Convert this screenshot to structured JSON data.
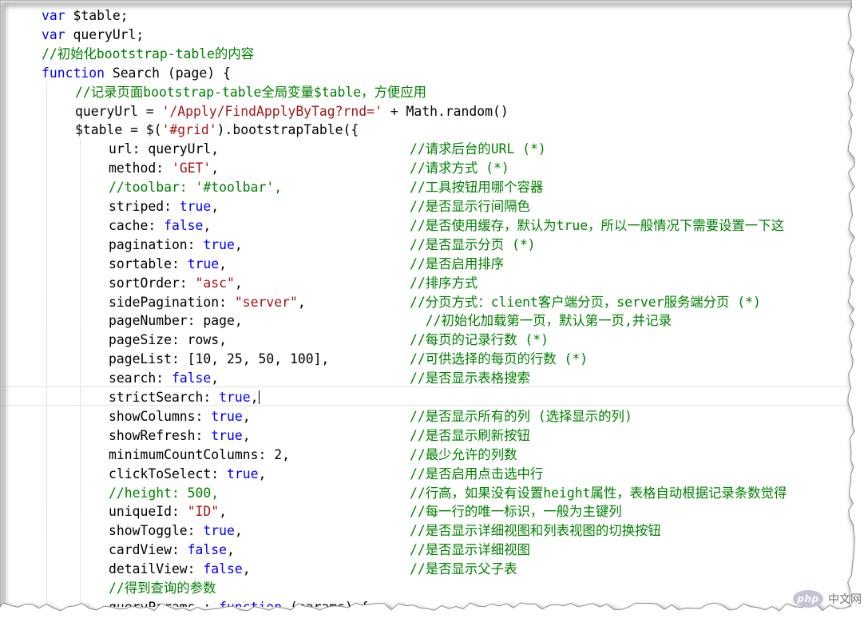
{
  "theme": {
    "keyword": "#0000ff",
    "string": "#a31515",
    "comment": "#008000",
    "plain": "#000000"
  },
  "editor": {
    "lines": [
      [
        {
          "t": "var",
          "c": "keyword"
        },
        {
          "t": " $table;",
          "c": "plain"
        }
      ],
      [
        {
          "t": "var",
          "c": "keyword"
        },
        {
          "t": " queryUrl;",
          "c": "plain"
        }
      ],
      [
        {
          "t": "//初始化bootstrap-table的内容",
          "c": "comment"
        }
      ],
      [
        {
          "t": "function",
          "c": "keyword"
        },
        {
          "t": " Search (page) {",
          "c": "plain"
        }
      ],
      [
        {
          "t": "//记录页面bootstrap-table全局变量$table，方便应用",
          "c": "comment"
        }
      ],
      [
        {
          "t": "queryUrl = ",
          "c": "plain"
        },
        {
          "t": "'/Apply/FindApplyByTag?rnd='",
          "c": "string"
        },
        {
          "t": " + Math.random()",
          "c": "plain"
        }
      ],
      [
        {
          "t": "$table = $(",
          "c": "plain"
        },
        {
          "t": "'#grid'",
          "c": "string"
        },
        {
          "t": ").bootstrapTable({",
          "c": "plain"
        }
      ],
      [
        {
          "t": "url: queryUrl,",
          "c": "plain"
        },
        {
          "t": "//请求后台的URL (*)",
          "c": "comment",
          "pad": true
        }
      ],
      [
        {
          "t": "method: ",
          "c": "plain"
        },
        {
          "t": "'GET'",
          "c": "string"
        },
        {
          "t": ",",
          "c": "plain"
        },
        {
          "t": "//请求方式 (*)",
          "c": "comment",
          "pad": true
        }
      ],
      [
        {
          "t": "//toolbar: '#toolbar',",
          "c": "comment"
        },
        {
          "t": "//工具按钮用哪个容器",
          "c": "comment",
          "pad": true
        }
      ],
      [
        {
          "t": "striped: ",
          "c": "plain"
        },
        {
          "t": "true",
          "c": "keyword"
        },
        {
          "t": ",",
          "c": "plain"
        },
        {
          "t": "//是否显示行间隔色",
          "c": "comment",
          "pad": true
        }
      ],
      [
        {
          "t": "cache: ",
          "c": "plain"
        },
        {
          "t": "false",
          "c": "keyword"
        },
        {
          "t": ",",
          "c": "plain"
        },
        {
          "t": "//是否使用缓存，默认为true，所以一般情况下需要设置一下这",
          "c": "comment",
          "pad": true
        }
      ],
      [
        {
          "t": "pagination: ",
          "c": "plain"
        },
        {
          "t": "true",
          "c": "keyword"
        },
        {
          "t": ",",
          "c": "plain"
        },
        {
          "t": "//是否显示分页 (*)",
          "c": "comment",
          "pad": true
        }
      ],
      [
        {
          "t": "sortable: ",
          "c": "plain"
        },
        {
          "t": "true",
          "c": "keyword"
        },
        {
          "t": ",",
          "c": "plain"
        },
        {
          "t": "//是否启用排序",
          "c": "comment",
          "pad": true
        }
      ],
      [
        {
          "t": "sortOrder: ",
          "c": "plain"
        },
        {
          "t": "\"asc\"",
          "c": "string"
        },
        {
          "t": ",",
          "c": "plain"
        },
        {
          "t": "//排序方式",
          "c": "comment",
          "pad": true
        }
      ],
      [
        {
          "t": "sidePagination: ",
          "c": "plain"
        },
        {
          "t": "\"server\"",
          "c": "string"
        },
        {
          "t": ",",
          "c": "plain"
        },
        {
          "t": "//分页方式：client客户端分页，server服务端分页 (*)",
          "c": "comment",
          "pad": true
        }
      ],
      [
        {
          "t": "pageNumber: page,",
          "c": "plain"
        },
        {
          "t": "  //初始化加载第一页，默认第一页,并记录",
          "c": "comment",
          "pad": true
        }
      ],
      [
        {
          "t": "pageSize: rows,",
          "c": "plain"
        },
        {
          "t": "//每页的记录行数 (*)",
          "c": "comment",
          "pad": true
        }
      ],
      [
        {
          "t": "pageList: [10, 25, 50, 100],",
          "c": "plain"
        },
        {
          "t": "//可供选择的每页的行数 (*)",
          "c": "comment",
          "pad": true
        }
      ],
      [
        {
          "t": "search: ",
          "c": "plain"
        },
        {
          "t": "false",
          "c": "keyword"
        },
        {
          "t": ",",
          "c": "plain"
        },
        {
          "t": "//是否显示表格搜索",
          "c": "comment",
          "pad": true
        }
      ],
      [
        {
          "t": "strictSearch: ",
          "c": "plain"
        },
        {
          "t": "true",
          "c": "keyword"
        },
        {
          "t": ",",
          "c": "plain"
        }
      ],
      [
        {
          "t": "showColumns: ",
          "c": "plain"
        },
        {
          "t": "true",
          "c": "keyword"
        },
        {
          "t": ",",
          "c": "plain"
        },
        {
          "t": "//是否显示所有的列 (选择显示的列)",
          "c": "comment",
          "pad": true
        }
      ],
      [
        {
          "t": "showRefresh: ",
          "c": "plain"
        },
        {
          "t": "true",
          "c": "keyword"
        },
        {
          "t": ",",
          "c": "plain"
        },
        {
          "t": "//是否显示刷新按钮",
          "c": "comment",
          "pad": true
        }
      ],
      [
        {
          "t": "minimumCountColumns: 2,",
          "c": "plain"
        },
        {
          "t": "//最少允许的列数",
          "c": "comment",
          "pad": true
        }
      ],
      [
        {
          "t": "clickToSelect: ",
          "c": "plain"
        },
        {
          "t": "true",
          "c": "keyword"
        },
        {
          "t": ",",
          "c": "plain"
        },
        {
          "t": "//是否启用点击选中行",
          "c": "comment",
          "pad": true
        }
      ],
      [
        {
          "t": "//height: 500,",
          "c": "comment"
        },
        {
          "t": "//行高，如果没有设置height属性，表格自动根据记录条数觉得",
          "c": "comment",
          "pad": true
        }
      ],
      [
        {
          "t": "uniqueId: ",
          "c": "plain"
        },
        {
          "t": "\"ID\"",
          "c": "string"
        },
        {
          "t": ",",
          "c": "plain"
        },
        {
          "t": "//每一行的唯一标识，一般为主键列",
          "c": "comment",
          "pad": true
        }
      ],
      [
        {
          "t": "showToggle: ",
          "c": "plain"
        },
        {
          "t": "true",
          "c": "keyword"
        },
        {
          "t": ",",
          "c": "plain"
        },
        {
          "t": "//是否显示详细视图和列表视图的切换按钮",
          "c": "comment",
          "pad": true
        }
      ],
      [
        {
          "t": "cardView: ",
          "c": "plain"
        },
        {
          "t": "false",
          "c": "keyword"
        },
        {
          "t": ",",
          "c": "plain"
        },
        {
          "t": "//是否显示详细视图",
          "c": "comment",
          "pad": true
        }
      ],
      [
        {
          "t": "detailView: ",
          "c": "plain"
        },
        {
          "t": "false",
          "c": "keyword"
        },
        {
          "t": ",",
          "c": "plain"
        },
        {
          "t": "//是否显示父子表",
          "c": "comment",
          "pad": true
        }
      ],
      [
        {
          "t": "//得到查询的参数",
          "c": "comment"
        }
      ],
      [
        {
          "t": "queryParams : ",
          "c": "plain"
        },
        {
          "t": "function",
          "c": "keyword"
        },
        {
          "t": " (params) {",
          "c": "plain"
        }
      ]
    ]
  },
  "watermark": {
    "logo": "php",
    "text": "中文网"
  }
}
